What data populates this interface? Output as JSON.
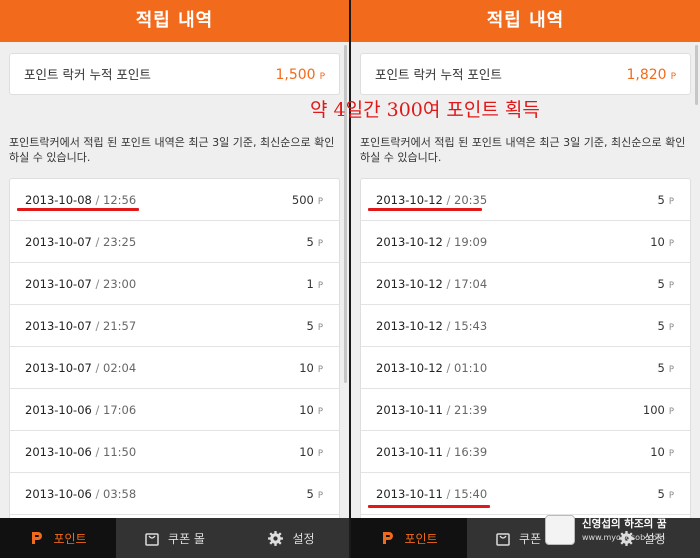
{
  "annotation": "약 4일간 300여 포인트 획득",
  "screens": [
    {
      "header_title": "적립 내역",
      "summary_label": "포인트 락커 누적 포인트",
      "summary_value": "1,500",
      "summary_unit": "P",
      "description": "포인트락커에서 적립 된 포인트 내역은 최근 3일 기준, 최신순으로 확인 하실 수 있습니다.",
      "rows": [
        {
          "date": "2013-10-08",
          "sep": " / ",
          "time": "12:56",
          "points": "500",
          "unit": "P"
        },
        {
          "date": "2013-10-07",
          "sep": " / ",
          "time": "23:25",
          "points": "5",
          "unit": "P"
        },
        {
          "date": "2013-10-07",
          "sep": " / ",
          "time": "23:00",
          "points": "1",
          "unit": "P"
        },
        {
          "date": "2013-10-07",
          "sep": " / ",
          "time": "21:57",
          "points": "5",
          "unit": "P"
        },
        {
          "date": "2013-10-07",
          "sep": " / ",
          "time": "02:04",
          "points": "10",
          "unit": "P"
        },
        {
          "date": "2013-10-06",
          "sep": " / ",
          "time": "17:06",
          "points": "10",
          "unit": "P"
        },
        {
          "date": "2013-10-06",
          "sep": " / ",
          "time": "11:50",
          "points": "10",
          "unit": "P"
        },
        {
          "date": "2013-10-06",
          "sep": " / ",
          "time": "03:58",
          "points": "5",
          "unit": "P"
        }
      ],
      "tabs": [
        {
          "label": "포인트",
          "icon": "point-logo-icon"
        },
        {
          "label": "쿠폰 몰",
          "icon": "shopping-bag-icon"
        },
        {
          "label": "설정",
          "icon": "gear-icon"
        }
      ]
    },
    {
      "header_title": "적립 내역",
      "summary_label": "포인트 락커 누적 포인트",
      "summary_value": "1,820",
      "summary_unit": "P",
      "description": "포인트락커에서 적립 된 포인트 내역은 최근 3일 기준, 최신순으로 확인 하실 수 있습니다.",
      "rows": [
        {
          "date": "2013-10-12",
          "sep": " / ",
          "time": "20:35",
          "points": "5",
          "unit": "P"
        },
        {
          "date": "2013-10-12",
          "sep": " / ",
          "time": "19:09",
          "points": "10",
          "unit": "P"
        },
        {
          "date": "2013-10-12",
          "sep": " / ",
          "time": "17:04",
          "points": "5",
          "unit": "P"
        },
        {
          "date": "2013-10-12",
          "sep": " / ",
          "time": "15:43",
          "points": "5",
          "unit": "P"
        },
        {
          "date": "2013-10-12",
          "sep": " / ",
          "time": "01:10",
          "points": "5",
          "unit": "P"
        },
        {
          "date": "2013-10-11",
          "sep": " / ",
          "time": "21:39",
          "points": "100",
          "unit": "P"
        },
        {
          "date": "2013-10-11",
          "sep": " / ",
          "time": "16:39",
          "points": "10",
          "unit": "P"
        },
        {
          "date": "2013-10-11",
          "sep": " / ",
          "time": "15:40",
          "points": "5",
          "unit": "P"
        }
      ],
      "tabs": [
        {
          "label": "포인트",
          "icon": "point-logo-icon"
        },
        {
          "label": "쿠폰 몰",
          "icon": "shopping-bag-icon"
        },
        {
          "label": "설정",
          "icon": "gear-icon"
        }
      ]
    }
  ],
  "watermark": {
    "line1": "신영섭의 하조의 꿈",
    "line2": "www.myongsob.com"
  },
  "colors": {
    "accent": "#f26a1b",
    "annotation": "#e01818",
    "tabbar": "#333333"
  }
}
